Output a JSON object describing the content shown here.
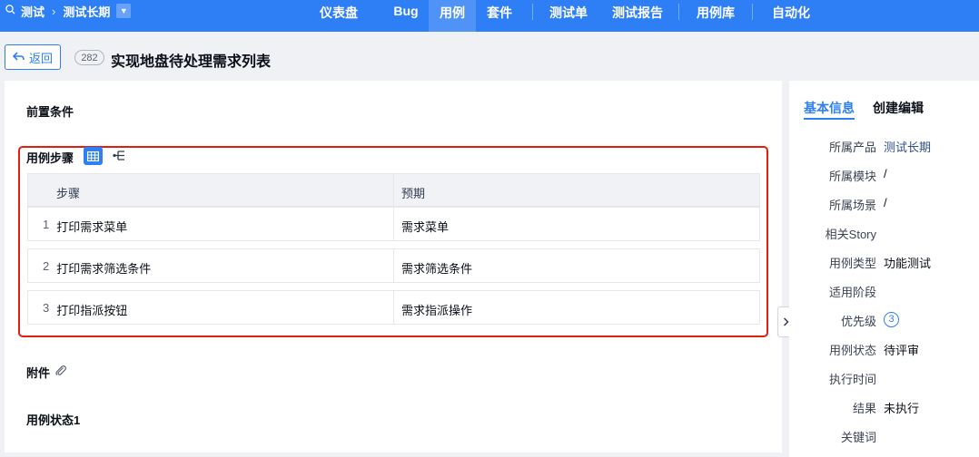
{
  "breadcrumb": {
    "root": "测试",
    "product": "测试长期"
  },
  "nav": {
    "items": [
      {
        "label": "仪表盘",
        "active": false
      },
      {
        "label": "Bug",
        "active": false
      },
      {
        "label": "用例",
        "active": true
      },
      {
        "label": "套件",
        "active": false
      },
      {
        "label": "测试单",
        "active": false
      },
      {
        "label": "测试报告",
        "active": false
      },
      {
        "label": "用例库",
        "active": false
      },
      {
        "label": "自动化",
        "active": false
      }
    ]
  },
  "header": {
    "back_label": "返回",
    "case_id": "282",
    "title": "实现地盘待处理需求列表"
  },
  "sections": {
    "precondition": "前置条件",
    "steps_title": "用例步骤",
    "attachments": "附件",
    "case_status": "用例状态1"
  },
  "steps_table": {
    "columns": [
      "步骤",
      "预期"
    ],
    "rows": [
      {
        "num": "1",
        "step": "打印需求菜单",
        "expect": "需求菜单"
      },
      {
        "num": "2",
        "step": "打印需求筛选条件",
        "expect": "需求筛选条件"
      },
      {
        "num": "3",
        "step": "打印指派按钮",
        "expect": "需求指派操作"
      }
    ]
  },
  "side": {
    "tabs": [
      "基本信息",
      "创建编辑"
    ],
    "fields": [
      {
        "label": "所属产品",
        "value": "测试长期"
      },
      {
        "label": "所属模块",
        "value": "/"
      },
      {
        "label": "所属场景",
        "value": "/"
      },
      {
        "label": "相关Story",
        "value": ""
      },
      {
        "label": "用例类型",
        "value": "功能测试"
      },
      {
        "label": "适用阶段",
        "value": ""
      },
      {
        "label": "优先级",
        "value": "3"
      },
      {
        "label": "用例状态",
        "value": "待评审"
      },
      {
        "label": "执行时间",
        "value": ""
      },
      {
        "label": "结果",
        "value": "未执行"
      },
      {
        "label": "关键词",
        "value": ""
      }
    ]
  },
  "colors": {
    "brand": "#2e7ff5",
    "highlight_border": "#e21e0f"
  },
  "icons": [
    "search-icon",
    "chevron-right-icon",
    "chevron-down-icon",
    "back-arrow-icon",
    "table-view-icon",
    "tree-view-icon",
    "paperclip-icon",
    "expand-panel-icon"
  ]
}
